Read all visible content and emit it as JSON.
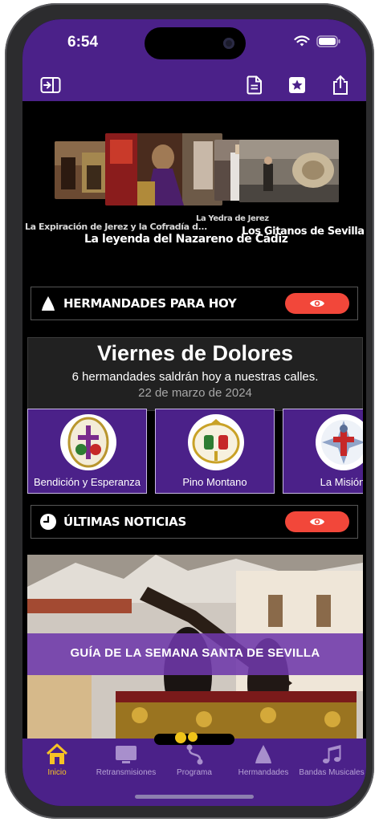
{
  "status_bar": {
    "time": "6:54"
  },
  "toolbar": {
    "sidebar_icon": "sidebar-toggle-icon",
    "document_icon": "document-icon",
    "favorites_icon": "star-bookmark-icon",
    "share_icon": "share-icon"
  },
  "featured": [
    {
      "caption": "La Expiración de Jerez y la Cofradía d..."
    },
    {
      "caption": "La leyenda del Nazareno de Cádiz"
    },
    {
      "caption": "La Yedra de Jerez"
    },
    {
      "caption": "Los Gitanos de Sevilla"
    }
  ],
  "today_section": {
    "title": "HERMANDADES PARA HOY",
    "icon": "capirote-icon",
    "action_icon": "eye-icon"
  },
  "day_card": {
    "title": "Viernes de Dolores",
    "subtitle": "6 hermandades saldrán hoy a nuestras calles.",
    "date": "22 de marzo de 2024"
  },
  "brotherhoods": [
    {
      "name": "Bendición y Esperanza"
    },
    {
      "name": "Pino Montano"
    },
    {
      "name": "La Misión"
    }
  ],
  "news_section": {
    "title": "ÚLTIMAS NOTICIAS",
    "icon": "clock-icon",
    "action_icon": "eye-icon"
  },
  "news": [
    {
      "title": "GUÍA DE LA SEMANA SANTA DE SEVILLA"
    }
  ],
  "tabs": [
    {
      "label": "Inicio",
      "icon": "home-icon",
      "active": true
    },
    {
      "label": "Retransmisiones",
      "icon": "tv-icon",
      "active": false
    },
    {
      "label": "Programa",
      "icon": "route-icon",
      "active": false
    },
    {
      "label": "Hermandades",
      "icon": "capirote-icon",
      "active": false
    },
    {
      "label": "Bandas Musicales",
      "icon": "music-notes-icon",
      "active": false
    }
  ],
  "colors": {
    "brand_purple": "#4b2189",
    "accent_red": "#f2473a",
    "active_tab": "#f7c325"
  }
}
